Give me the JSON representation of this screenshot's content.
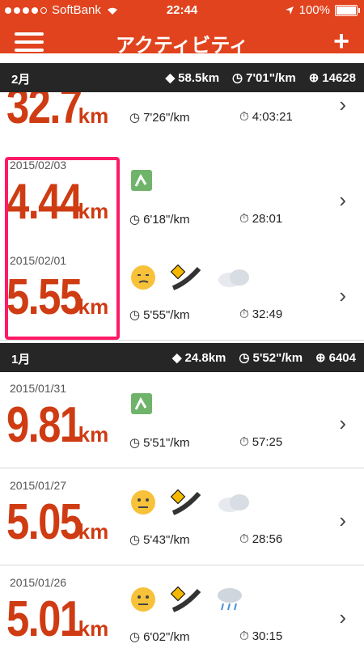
{
  "status": {
    "carrier": "SoftBank",
    "time": "22:44",
    "battery": "100%"
  },
  "nav": {
    "title": "アクティビティ",
    "plus": "+"
  },
  "sections": {
    "feb": {
      "month": "2月",
      "distance": "58.5km",
      "pace": "7'01\"/km",
      "steps": "14628"
    },
    "jan": {
      "month": "1月",
      "distance": "24.8km",
      "pace": "5'52\"/km",
      "steps": "6404"
    }
  },
  "runs": [
    {
      "date": "",
      "distance": "32.7",
      "unit": "km",
      "pace": "7'26\"/km",
      "time": "4:03:21",
      "icons": [
        "smiley-icon",
        "road-icon",
        "map-icon"
      ]
    },
    {
      "date": "2015/02/03",
      "distance": "4.44",
      "unit": "km",
      "pace": "6'18\"/km",
      "time": "28:01",
      "icons": [
        "map-icon"
      ]
    },
    {
      "date": "2015/02/01",
      "distance": "5.55",
      "unit": "km",
      "pace": "5'55\"/km",
      "time": "32:49",
      "icons": [
        "smirk-icon",
        "road-icon",
        "cloud-icon"
      ]
    },
    {
      "date": "2015/01/31",
      "distance": "9.81",
      "unit": "km",
      "pace": "5'51\"/km",
      "time": "57:25",
      "icons": [
        "map-icon"
      ]
    },
    {
      "date": "2015/01/27",
      "distance": "5.05",
      "unit": "km",
      "pace": "5'43\"/km",
      "time": "28:56",
      "icons": [
        "neutral-face-icon",
        "road-icon",
        "cloud-icon"
      ]
    },
    {
      "date": "2015/01/26",
      "distance": "5.01",
      "unit": "km",
      "pace": "6'02\"/km",
      "time": "30:15",
      "icons": [
        "neutral-face-icon",
        "road-icon",
        "rain-icon"
      ]
    }
  ],
  "colors": {
    "accent": "#e1431e",
    "distance": "#cf3b12",
    "highlight": "#ff1a66",
    "header": "#262626"
  }
}
